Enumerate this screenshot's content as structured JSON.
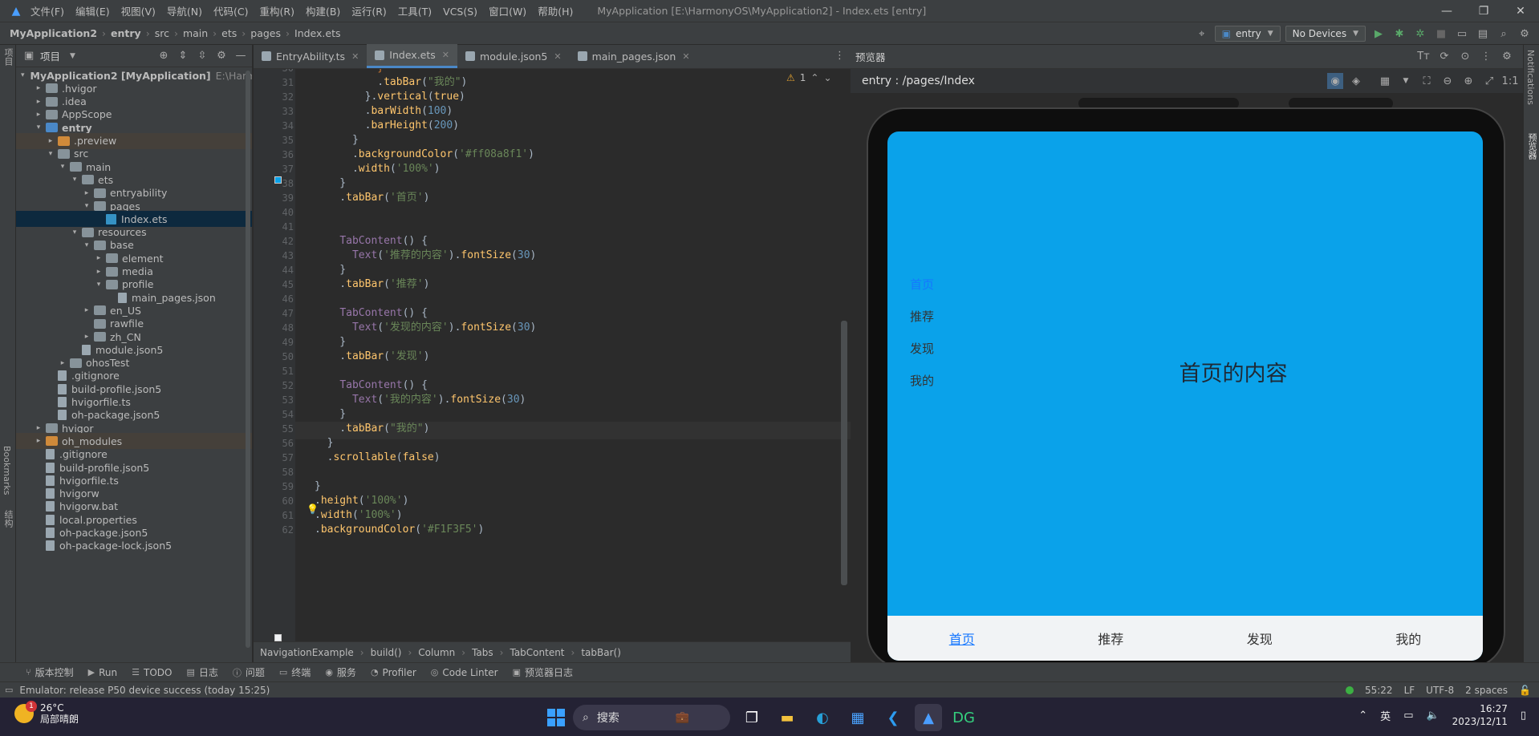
{
  "app": {
    "menu": [
      "文件(F)",
      "编辑(E)",
      "视图(V)",
      "导航(N)",
      "代码(C)",
      "重构(R)",
      "构建(B)",
      "运行(R)",
      "工具(T)",
      "VCS(S)",
      "窗口(W)",
      "帮助(H)"
    ],
    "window_title": "MyApplication [E:\\HarmonyOS\\MyApplication2] - Index.ets [entry]"
  },
  "navbar": {
    "crumbs": [
      "MyApplication2",
      "entry",
      "src",
      "main",
      "ets",
      "pages",
      "Index.ets"
    ],
    "module_select": "entry",
    "device_select": "No Devices"
  },
  "project": {
    "title": "项目",
    "tree": [
      {
        "label": "MyApplication2 [MyApplication]",
        "extra": "E:\\Harm",
        "depth": 0,
        "arrow": "▾",
        "icon": "mod",
        "bold": true
      },
      {
        "label": ".hvigor",
        "depth": 1,
        "arrow": "▸",
        "icon": "folder"
      },
      {
        "label": ".idea",
        "depth": 1,
        "arrow": "▸",
        "icon": "folder"
      },
      {
        "label": "AppScope",
        "depth": 1,
        "arrow": "▸",
        "icon": "folder"
      },
      {
        "label": "entry",
        "depth": 1,
        "arrow": "▾",
        "icon": "mod",
        "bold": true
      },
      {
        "label": ".preview",
        "depth": 2,
        "arrow": "▸",
        "icon": "ex",
        "ex": true
      },
      {
        "label": "src",
        "depth": 2,
        "arrow": "▾",
        "icon": "folder"
      },
      {
        "label": "main",
        "depth": 3,
        "arrow": "▾",
        "icon": "folder"
      },
      {
        "label": "ets",
        "depth": 4,
        "arrow": "▾",
        "icon": "folder"
      },
      {
        "label": "entryability",
        "depth": 5,
        "arrow": "▸",
        "icon": "folder"
      },
      {
        "label": "pages",
        "depth": 5,
        "arrow": "▾",
        "icon": "folder"
      },
      {
        "label": "Index.ets",
        "depth": 6,
        "arrow": "",
        "icon": "ets",
        "sel": true
      },
      {
        "label": "resources",
        "depth": 4,
        "arrow": "▾",
        "icon": "folder"
      },
      {
        "label": "base",
        "depth": 5,
        "arrow": "▾",
        "icon": "folder"
      },
      {
        "label": "element",
        "depth": 6,
        "arrow": "▸",
        "icon": "folder"
      },
      {
        "label": "media",
        "depth": 6,
        "arrow": "▸",
        "icon": "folder"
      },
      {
        "label": "profile",
        "depth": 6,
        "arrow": "▾",
        "icon": "folder"
      },
      {
        "label": "main_pages.json",
        "depth": 7,
        "arrow": "",
        "icon": "file"
      },
      {
        "label": "en_US",
        "depth": 5,
        "arrow": "▸",
        "icon": "folder"
      },
      {
        "label": "rawfile",
        "depth": 5,
        "arrow": "",
        "icon": "folder"
      },
      {
        "label": "zh_CN",
        "depth": 5,
        "arrow": "▸",
        "icon": "folder"
      },
      {
        "label": "module.json5",
        "depth": 4,
        "arrow": "",
        "icon": "file"
      },
      {
        "label": "ohosTest",
        "depth": 3,
        "arrow": "▸",
        "icon": "folder"
      },
      {
        "label": ".gitignore",
        "depth": 2,
        "arrow": "",
        "icon": "file"
      },
      {
        "label": "build-profile.json5",
        "depth": 2,
        "arrow": "",
        "icon": "file"
      },
      {
        "label": "hvigorfile.ts",
        "depth": 2,
        "arrow": "",
        "icon": "file"
      },
      {
        "label": "oh-package.json5",
        "depth": 2,
        "arrow": "",
        "icon": "file"
      },
      {
        "label": "hvigor",
        "depth": 1,
        "arrow": "▸",
        "icon": "folder"
      },
      {
        "label": "oh_modules",
        "depth": 1,
        "arrow": "▸",
        "icon": "ex",
        "ex": true
      },
      {
        "label": ".gitignore",
        "depth": 1,
        "arrow": "",
        "icon": "file"
      },
      {
        "label": "build-profile.json5",
        "depth": 1,
        "arrow": "",
        "icon": "file"
      },
      {
        "label": "hvigorfile.ts",
        "depth": 1,
        "arrow": "",
        "icon": "file"
      },
      {
        "label": "hvigorw",
        "depth": 1,
        "arrow": "",
        "icon": "file"
      },
      {
        "label": "hvigorw.bat",
        "depth": 1,
        "arrow": "",
        "icon": "file"
      },
      {
        "label": "local.properties",
        "depth": 1,
        "arrow": "",
        "icon": "file"
      },
      {
        "label": "oh-package.json5",
        "depth": 1,
        "arrow": "",
        "icon": "file"
      },
      {
        "label": "oh-package-lock.json5",
        "depth": 1,
        "arrow": "",
        "icon": "file"
      }
    ]
  },
  "left_strip": {
    "top": "项目",
    "bottom": "Bookmarks",
    "bottom2": "结构"
  },
  "editor": {
    "tabs": [
      {
        "label": "EntryAbility.ts",
        "active": false
      },
      {
        "label": "Index.ets",
        "active": true
      },
      {
        "label": "module.json5",
        "active": false
      },
      {
        "label": "main_pages.json",
        "active": false
      }
    ],
    "warnings": "1",
    "first_line": 30,
    "lines": [
      "<span class=\"k\">          }</span>",
      "          .<span class=\"m\">tabBar</span>(<span class=\"s\">\"我的\"</span>)",
      "        }.<span class=\"m\">vertical</span>(<span class=\"bt\">true</span>)",
      "        .<span class=\"m\">barWidth</span>(<span class=\"n\">100</span>)",
      "        .<span class=\"m\">barHeight</span>(<span class=\"n\">200</span>)",
      "      }",
      "      .<span class=\"m\">backgroundColor</span>(<span class=\"s\">'#ff08a8f1'</span>)",
      "      .<span class=\"m\">width</span>(<span class=\"s\">'100%'</span>)",
      "    }",
      "    .<span class=\"m\">tabBar</span>(<span class=\"s\">'首页'</span>)",
      "",
      "",
      "    <span class=\"p\">TabContent</span>() {",
      "      <span class=\"p\">Text</span>(<span class=\"s\">'推荐的内容'</span>).<span class=\"m\">fontSize</span>(<span class=\"n\">30</span>)",
      "    }",
      "    .<span class=\"m\">tabBar</span>(<span class=\"s\">'推荐'</span>)",
      "",
      "    <span class=\"p\">TabContent</span>() {",
      "      <span class=\"p\">Text</span>(<span class=\"s\">'发现的内容'</span>).<span class=\"m\">fontSize</span>(<span class=\"n\">30</span>)",
      "    }",
      "    .<span class=\"m\">tabBar</span>(<span class=\"s\">'发现'</span>)",
      "",
      "    <span class=\"p\">TabContent</span>() {",
      "      <span class=\"p\">Text</span>(<span class=\"s\">'我的内容'</span>).<span class=\"m\">fontSize</span>(<span class=\"n\">30</span>)",
      "    }",
      "    .<span class=\"m\">tabBar</span>(<span class=\"s\">\"我的\"</span>)",
      "  }",
      "  .<span class=\"m\">scrollable</span>(<span class=\"bt\">false</span>)",
      "",
      "}",
      ".<span class=\"m\">height</span>(<span class=\"s\">'100%'</span>)",
      ".<span class=\"m\">width</span>(<span class=\"s\">'100%'</span>)",
      ".<span class=\"m\">backgroundColor</span>(<span class=\"s\">'#F1F3F5'</span>)"
    ],
    "current_line": 55,
    "breadcrumb": [
      "NavigationExample",
      "build()",
      "Column",
      "Tabs",
      "TabContent",
      "tabBar()"
    ]
  },
  "preview": {
    "panel_title": "预览器",
    "route": "entry : /pages/Index",
    "vertical_tabs": [
      "首页",
      "推荐",
      "发现",
      "我的"
    ],
    "content": "首页的内容",
    "bottom_tabs": [
      "首页",
      "推荐",
      "发现",
      "我的"
    ],
    "screen_color": "#0aa2ea"
  },
  "right_strip": {
    "a": "Notifications",
    "b": "预览器"
  },
  "tool_windows": [
    {
      "icon": "⑂",
      "label": "版本控制"
    },
    {
      "icon": "▶",
      "label": "Run"
    },
    {
      "icon": "☰",
      "label": "TODO"
    },
    {
      "icon": "▤",
      "label": "日志"
    },
    {
      "icon": "ⓘ",
      "label": "问题"
    },
    {
      "icon": "▭",
      "label": "终端"
    },
    {
      "icon": "◉",
      "label": "服务"
    },
    {
      "icon": "◔",
      "label": "Profiler"
    },
    {
      "icon": "◎",
      "label": "Code Linter"
    },
    {
      "icon": "▣",
      "label": "预览器日志"
    }
  ],
  "status": {
    "message": "Emulator: release P50 device success (today 15:25)",
    "pos": "55:22",
    "eol": "LF",
    "enc": "UTF-8",
    "indent": "2 spaces"
  },
  "taskbar": {
    "temp": "26°C",
    "weather": "局部晴朗",
    "badge": "1",
    "search": "搜索",
    "ime": "英",
    "time": "16:27",
    "date": "2023/12/11"
  }
}
